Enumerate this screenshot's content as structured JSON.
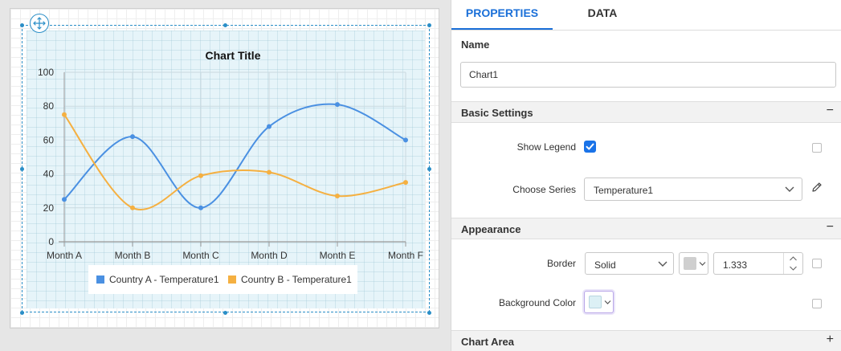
{
  "tabs": {
    "properties": "PROPERTIES",
    "data": "DATA"
  },
  "name_section": {
    "label": "Name",
    "value": "Chart1"
  },
  "basic_settings": {
    "title": "Basic Settings",
    "toggle": "−",
    "show_legend": {
      "label": "Show Legend",
      "checked": true
    },
    "choose_series": {
      "label": "Choose Series",
      "value": "Temperature1"
    }
  },
  "appearance": {
    "title": "Appearance",
    "toggle": "−",
    "border": {
      "label": "Border",
      "style": "Solid",
      "width": "1.333"
    },
    "background": {
      "label": "Background Color",
      "swatch": "#dcf0f5"
    }
  },
  "chart_area": {
    "title": "Chart Area",
    "toggle": "+"
  },
  "chart_data": {
    "type": "line",
    "title": "Chart Title",
    "categories": [
      "Month A",
      "Month B",
      "Month C",
      "Month D",
      "Month E",
      "Month F"
    ],
    "ylim": [
      0,
      100
    ],
    "yticks": [
      "0",
      "20",
      "40",
      "60",
      "80",
      "100"
    ],
    "smooth": true,
    "grid": true,
    "legend_position": "bottom",
    "series": [
      {
        "name": "Country A - Temperature1",
        "color": "#4a90e2",
        "values": [
          25,
          62,
          20,
          68,
          81,
          60
        ]
      },
      {
        "name": "Country B - Temperature1",
        "color": "#f5b041",
        "values": [
          75,
          20,
          39,
          41,
          27,
          35
        ]
      }
    ]
  }
}
